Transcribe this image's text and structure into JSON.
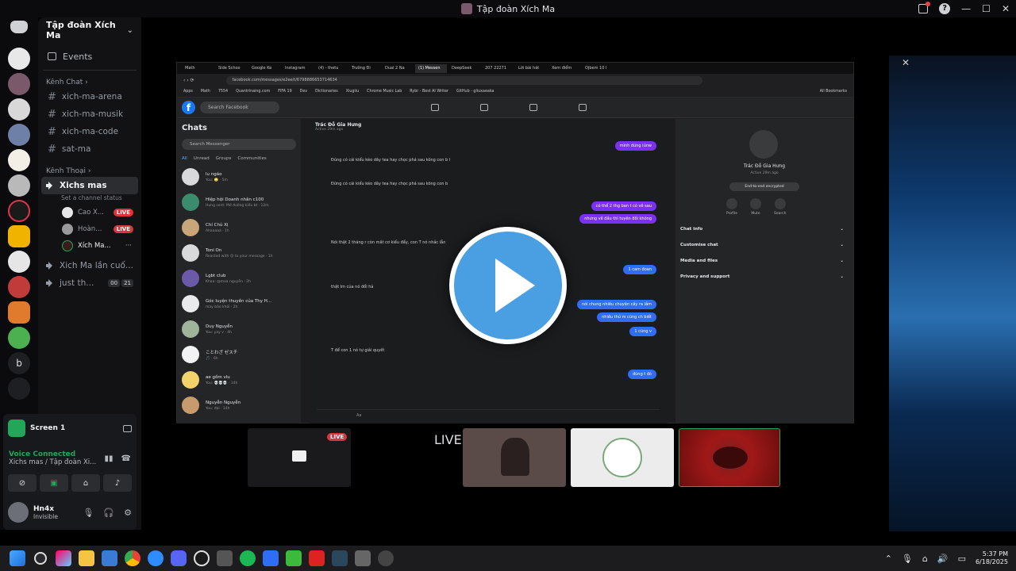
{
  "window": {
    "title": "Tập đoàn Xích Ma"
  },
  "guild": {
    "name": "Tập đoàn Xích Ma",
    "events_label": "Events",
    "text_category": "Kênh Chat",
    "text_channels": [
      "xich-ma-arena",
      "xich-ma-musik",
      "xich-ma-code",
      "sat-ma"
    ],
    "voice_category": "Kênh Thoại",
    "active_voice": {
      "name": "Xichs mas",
      "status_placeholder": "Set a channel status"
    },
    "members": [
      {
        "name": "Cao X...",
        "live": "LIVE"
      },
      {
        "name": "Hoàn...",
        "live": "LIVE"
      },
      {
        "name": "Xích Ma...",
        "live": ""
      }
    ],
    "other_voice": [
      {
        "name": "Xich Ma lần cuố..."
      },
      {
        "name": "just th...",
        "c1": "00",
        "c2": "21"
      }
    ]
  },
  "panel": {
    "screen_label": "Screen 1",
    "voice_status": "Voice Connected",
    "voice_location": "Xichs mas / Tập đoàn Xi...",
    "user_name": "Hn4x",
    "user_status": "Invisible"
  },
  "stream": {
    "tabs": [
      "Math",
      "Side Schoo",
      "Google Ke",
      "Instagram",
      "(4) - thetu",
      "Trường Đi",
      "Dual 2 Na",
      "(1) Messen",
      "DeepSeek",
      "207 22271",
      "Lời bài hát",
      "Xem điểm",
      "Ojbem 10 I"
    ],
    "url": "facebook.com/messages/e2ee/t/6798886653714634",
    "bookmarks": [
      "Apps",
      "Math",
      "7554",
      "Quantrinaing.com",
      "FIFA 19",
      "Dev",
      "Dictionaries",
      "Xiugiiu",
      "Chrome Music Lab",
      "Rybr - Best AI Writer",
      "GitHub - gliuxaeaka",
      "All Bookmarks"
    ],
    "fb_search": "Search Facebook",
    "chats_title": "Chats",
    "messenger_search": "Search Messenger",
    "filters": [
      "All",
      "Unread",
      "Groups",
      "Communities"
    ],
    "chats": [
      {
        "name": "lu ngáo",
        "msg": "You: 🙄 · 5m",
        "color": "#d9d9d9"
      },
      {
        "name": "Hiệp hội Doanh nhân c100",
        "msg": "Hưng sent: Mở đường kiểu bt · 12m",
        "color": "#3b8c6e"
      },
      {
        "name": "Chí Chủ Xị",
        "msg": "Ahaaaaa · 1h",
        "color": "#c9a57a"
      },
      {
        "name": "Toni On",
        "msg": "Reacted with 😮 to your message · 1h",
        "color": "#d9d9d9"
      },
      {
        "name": "Lgbt club",
        "msg": "Khoa: @mxa nguyễn · 2h",
        "color": "#6b5aa8"
      },
      {
        "name": "Góc luyện thuyền của Thy H...",
        "msg": "may bảo khói · 2h",
        "color": "#eaeaea"
      },
      {
        "name": "Duy Nguyễn",
        "msg": "You: yay v · 4h",
        "color": "#a0b49c"
      },
      {
        "name": "ことわざ ゼスチ",
        "msg": "🎵 · 6h",
        "color": "#f2f2f2"
      },
      {
        "name": "ae gồm vlu",
        "msg": "You: 💀💀💀 · 14h",
        "color": "#f2d36b"
      },
      {
        "name": "Nguyễn Nguyễn",
        "msg": "You: đại · 14h",
        "color": "#c79b6e"
      }
    ],
    "convo_name": "Trác Đỗ Gia Hưng",
    "convo_sub": "Active 29m ago",
    "messages": [
      {
        "kind": "me",
        "text": "mình đúng lúnw"
      },
      {
        "kind": "them",
        "text": "Đúng có cái kiểu kéo dây tea hay chọc phá sau kông con b l"
      },
      {
        "kind": "them",
        "text": "Đừng có cái kiểu kéo dây tea hay chọc phá sau kông con b"
      },
      {
        "kind": "me",
        "text": "có thể 2 thg ban t có về sau"
      },
      {
        "kind": "me",
        "text": "nhưng về đầu thì tuyên đối không"
      },
      {
        "kind": "them",
        "text": "Nói thật 2 tháng r còn mất cơ kiểu đẩy, con T nó nhắc lẫn"
      },
      {
        "kind": "blue",
        "text": "1 cam đoan"
      },
      {
        "kind": "them",
        "text": "thật lm của nó đổi hả"
      },
      {
        "kind": "blue",
        "text": "nói chung nhiều chuyện cấy ra lắm"
      },
      {
        "kind": "blue",
        "text": "nhiều thứ m cũng ch biết"
      },
      {
        "kind": "blue",
        "text": "1 cũng v"
      },
      {
        "kind": "them",
        "text": "T để con 1 nó tự giải quyết"
      },
      {
        "kind": "blue",
        "text": "đúng t đó"
      }
    ],
    "compose_placeholder": "Aa",
    "info_name": "Trác Đỗ Gia Hưng",
    "info_sub": "Active 29m ago",
    "info_enc": "End-to-end encrypted",
    "info_actions": [
      "Profile",
      "Mute",
      "Search"
    ],
    "info_sections": [
      "Chat info",
      "Customise chat",
      "Media and files",
      "Privacy and support"
    ]
  },
  "tiles": {
    "live1": "LIVE",
    "live2": "LIVE"
  },
  "taskbar": {
    "time": "5:37 PM",
    "date": "6/18/2025"
  },
  "colors": {
    "live": "#da373c",
    "voice_green": "#23a55a",
    "play_blue": "#4a9fe3"
  }
}
